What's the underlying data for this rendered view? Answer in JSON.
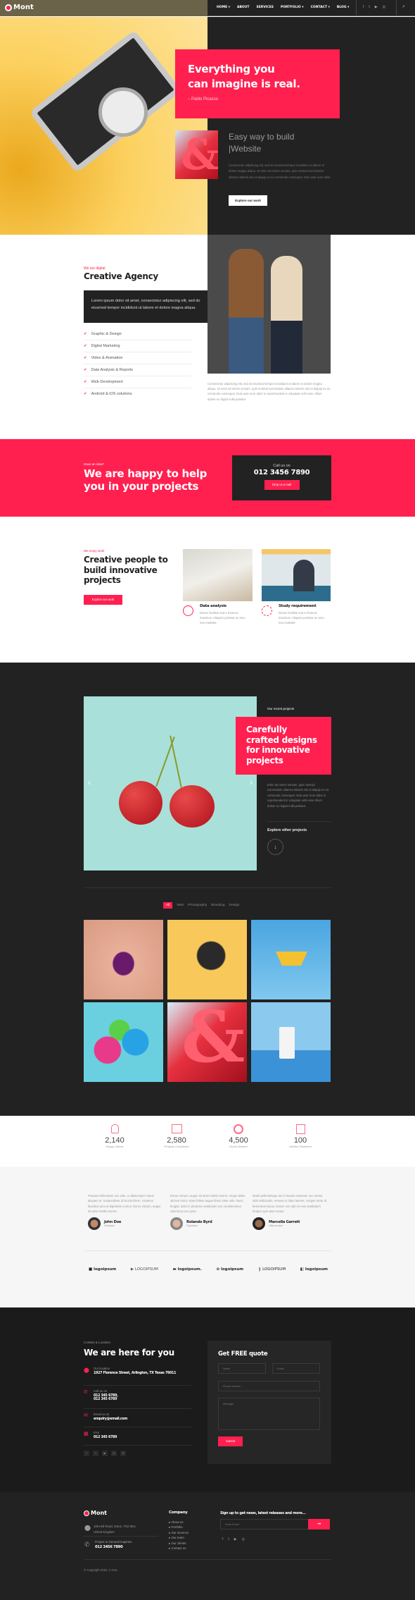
{
  "colors": {
    "accent": "#ff2050",
    "dark": "#222222",
    "yellow": "#fcd160"
  },
  "nav": {
    "logo": "Mont",
    "items": [
      {
        "label": "HOME",
        "dropdown": true
      },
      {
        "label": "ABOUT"
      },
      {
        "label": "SERVICES"
      },
      {
        "label": "PORTFOLIO",
        "dropdown": true
      },
      {
        "label": "CONTACT",
        "dropdown": true
      },
      {
        "label": "BLOG",
        "dropdown": true
      }
    ],
    "social": [
      "facebook-icon",
      "twitter-icon",
      "youtube-icon",
      "instagram-icon"
    ],
    "search": "search-icon"
  },
  "hero": {
    "title_line1": "Everything you",
    "title_line2": "can imagine is real.",
    "quote_author": "– Pablo Picasso",
    "subtitle_line1": "Easy way to build",
    "subtitle_line2": "|Website",
    "text": "Consectetur adipiscing elit, sed do eiusmod tempor incididunt ut labore et dolore magna aliqua. Ut enim ad minim veniam, quis nostrud exercitation ullamco laboris nisi ut aliquip ex ea commodo consequat. Duis aute irure dolor",
    "button": "Explore our work"
  },
  "about": {
    "kicker": "We are digital",
    "title": "Creative Agency",
    "box_text": "Lorem ipsum dolor sit amet, consectetur adipiscing elit, sed do eiusmod tempor incididunt ut labore et dolore magna aliqua.",
    "list": [
      "Graphic & Design",
      "Digital Marketing",
      "Video & Animation",
      "Data Analysis & Reports",
      "Web Development",
      "Android & iOS solutions"
    ],
    "side_text": "Consectetur adipiscing elit, sed do eiusmod tempor incididunt ut labore et dolore magna aliqua. Ut enim ad minim veniam, quis nostrud exercitation ullamco laboris nisi ut aliquip ex ea commodo consequat. Duis aute irure dolor in reprehenderit in voluptate velit esse cillum dolore eu fugiat nulla pariatur."
  },
  "cta": {
    "kicker": "Have an idea?",
    "title_line1": "We are happy to help",
    "title_line2": "you in your projects",
    "call_label": "Call us on",
    "phone": "012 3456 7890",
    "button": "Drop us a mail"
  },
  "work": {
    "kicker": "We enjoy work",
    "title": "Creative people to build innovative projects",
    "button": "Explore our work",
    "cards": [
      {
        "title": "Data analysis",
        "text": "Donec facilisis erat a rhoncus maximus. Aliquam pulvinar ac arcu non molestie",
        "icon": "data-analysis-icon"
      },
      {
        "title": "Study requirement",
        "text": "Donec facilisis erat a rhoncus maximus. Aliquam pulvinar ac arcu non molestie",
        "icon": "lightbulb-icon"
      }
    ]
  },
  "projects": {
    "kicker": "Our recent projects",
    "title": "Carefully crafted designs for innovative projects",
    "text": "Enim ad minim veniam, quis nostrud exercitation ullamco laboris nisi ut aliquip ex ea commodo consequat. Duis aute irure dolor in reprehenderit in voluptate velit esse cillum dolore eu fugiat nulla pariatur.",
    "explore": "Explore other projects",
    "filters": [
      "All",
      "Web",
      "Photography",
      "Branding",
      "Design"
    ],
    "active_filter": "All",
    "gallery": [
      "lips",
      "camera",
      "paper-boat",
      "kettlebells",
      "ampersand",
      "milk-glass"
    ]
  },
  "stats": [
    {
      "value": "2,140",
      "label": "Happy Clients",
      "icon": "client-icon"
    },
    {
      "value": "2,580",
      "label": "Projects Completed",
      "icon": "projects-icon"
    },
    {
      "value": "4,500",
      "label": "Hours Worked",
      "icon": "clock-icon"
    },
    {
      "value": "100",
      "label": "Articles Published",
      "icon": "article-icon"
    }
  ],
  "testimonials": [
    {
      "text": "Praesent bibendum orci ante, a ullamcorper metus aliquam et. Suspendisse id lacinia libero. Vivamus faucibus arcu at dignissim cursus. Donec dictum, augue sit amet mattis viverra",
      "name": "John Doe",
      "role": "Designer"
    },
    {
      "text": "Donec dictum, augue sit amet mattis viverra, neque tellus ultrices tortor, vitae finibus augue libero vitae odio. Nunc feugiat, dolor in pharetra vestibulum non condimentum odio lacus nec justo",
      "name": "Rolando Byrd",
      "role": "Dignissim"
    },
    {
      "text": "Morbi pellentesque dui id mauris euismod, nec lacinia nibh sollicitudin. Aenean in diam laoreet, congue tortor id, fermentum lacus. Donec non odio et erat vestibulum tempor quis vitae metus.",
      "name": "Marcella Garrett",
      "role": "Ullamcorper"
    }
  ],
  "logos": [
    "logoipsum",
    "LOGOIPSUM",
    "logoipsum.",
    "logoipsum",
    "LOGOIPSUM",
    "logoipsum"
  ],
  "contact": {
    "kicker": "Contact & Location",
    "title": "We are here for you",
    "items": [
      {
        "label": "Our location",
        "value": "1927 Florence Street, Arlington, TX Texas 76011",
        "icon": "location-icon"
      },
      {
        "label": "Call us on",
        "value": "012 345 6789,",
        "value2": "012 345 6789",
        "icon": "phone-icon"
      },
      {
        "label": "Email us on",
        "value": "enquiry@email.com",
        "icon": "email-icon"
      },
      {
        "label": "FAX",
        "value": "012 345 6789",
        "icon": "fax-icon"
      }
    ],
    "social": [
      "facebook-icon",
      "twitter-icon",
      "youtube-icon",
      "instagram-icon",
      "dribbble-icon"
    ],
    "form": {
      "title": "Get FREE quote",
      "name_placeholder": "Name",
      "email_placeholder": "Email",
      "phone_placeholder": "Phone number",
      "message_placeholder": "Message",
      "submit": "Submit"
    }
  },
  "footer": {
    "logo": "Mont",
    "address_line1": "106 Hull Road, Oxton, TD2 6EU,",
    "address_line2": "United Kingdom",
    "inquiry_label": "Project or General Inquiries",
    "phone": "012 3456 7890",
    "company_title": "Company",
    "company_links": [
      "About us",
      "Portfolio",
      "Our services",
      "Our team",
      "Our clients",
      "Contact us"
    ],
    "newsletter_title": "Sign up to get news, latest releases and more...",
    "email_placeholder": "Enter Email",
    "social": [
      "facebook-icon",
      "twitter-icon",
      "youtube-icon",
      "instagram-icon"
    ],
    "copyright": "© Copyright 2022, C-Kav"
  }
}
